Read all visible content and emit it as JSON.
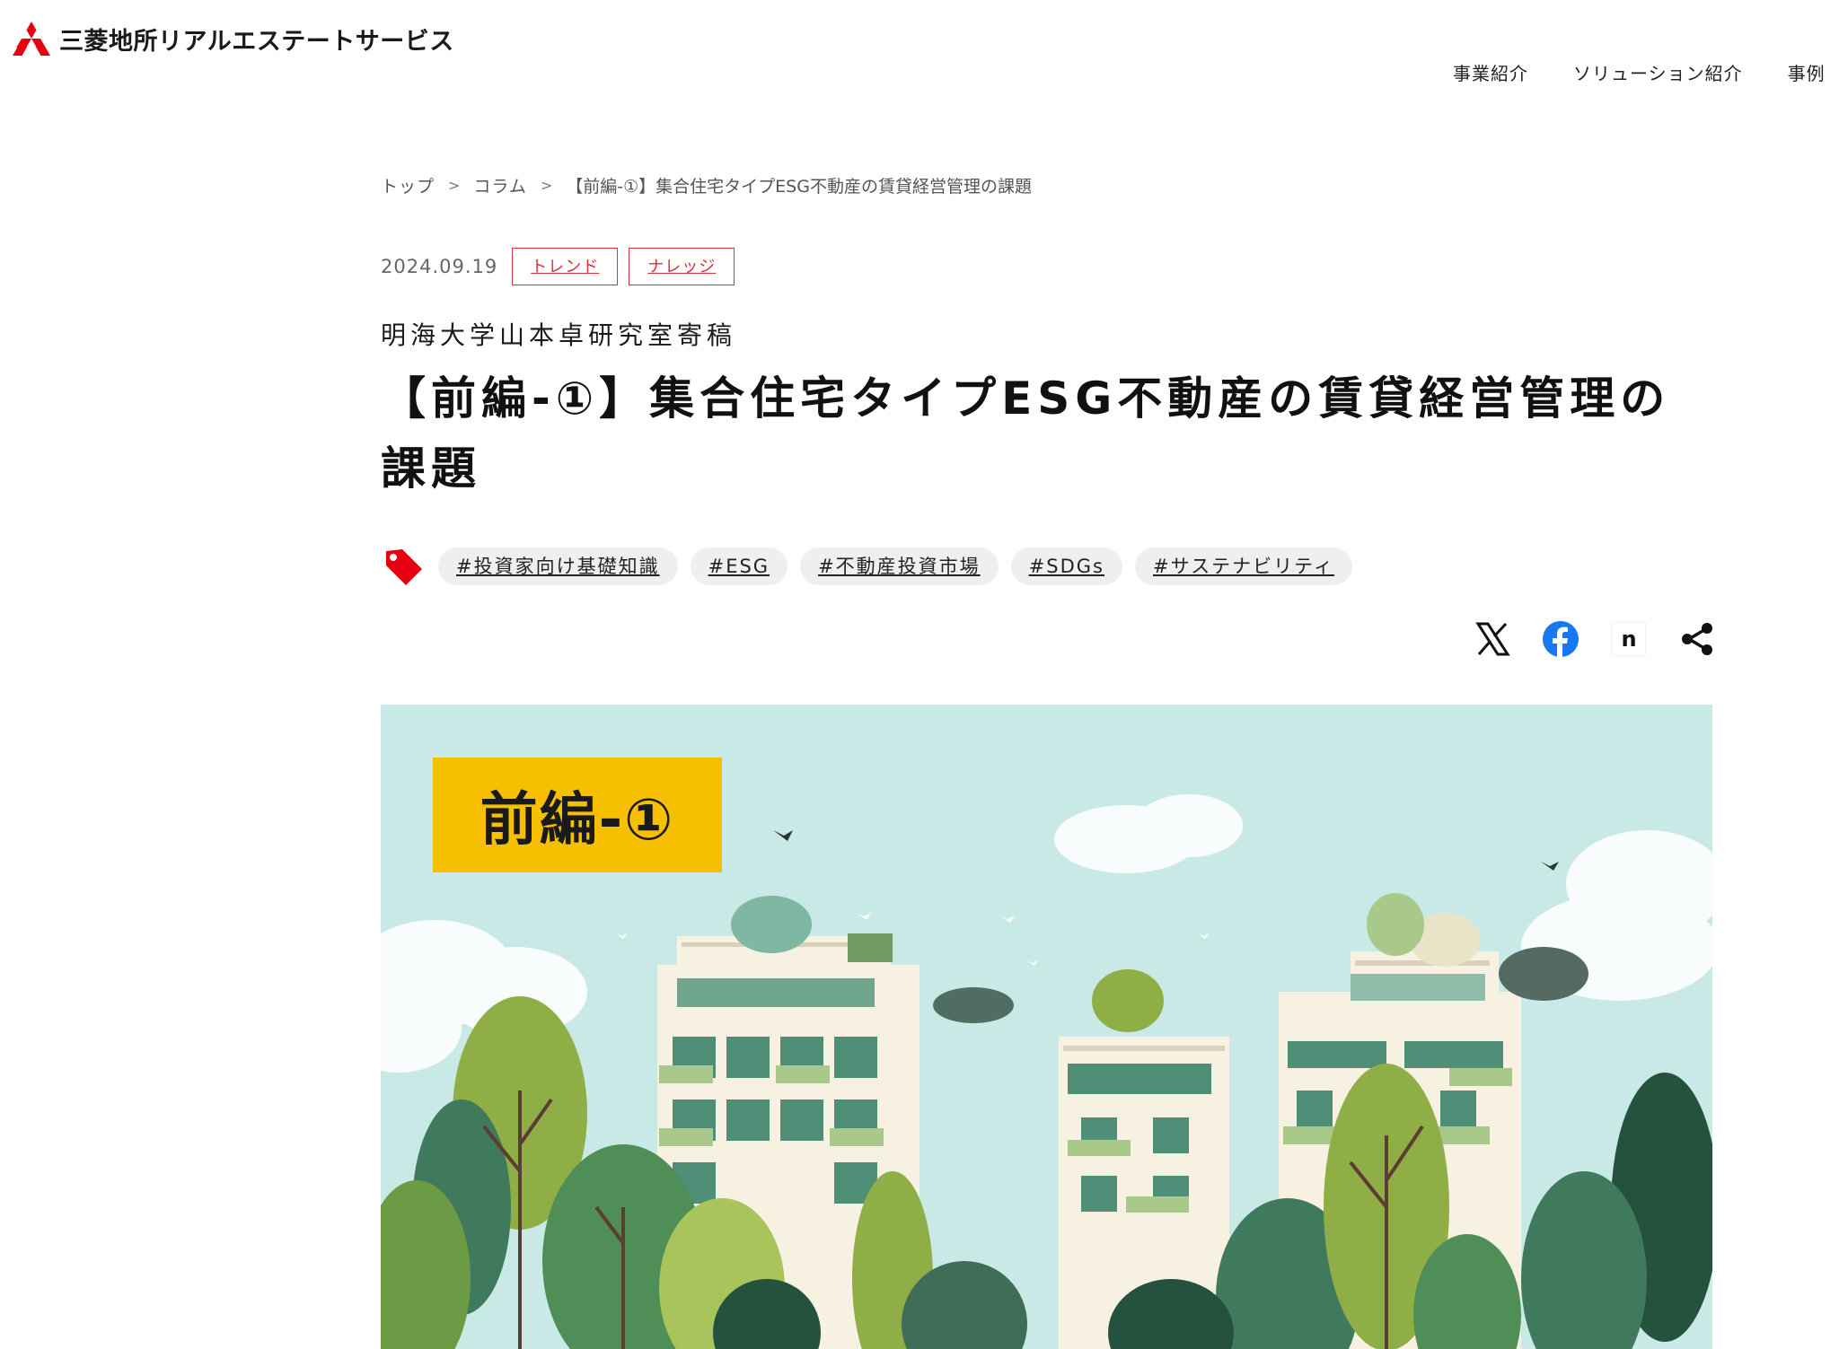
{
  "header": {
    "logo_text": "三菱地所リアルエステートサービス",
    "nav": [
      "事業紹介",
      "ソリューション紹介",
      "事例"
    ]
  },
  "breadcrumb": {
    "items": [
      "トップ",
      "コラム",
      "【前編-①】集合住宅タイプESG不動産の賃貸経営管理の課題"
    ],
    "separator": ">"
  },
  "article": {
    "date": "2024.09.19",
    "categories": [
      "トレンド",
      "ナレッジ"
    ],
    "subtitle": "明海大学山本卓研究室寄稿",
    "title": "【前編-①】集合住宅タイプESG不動産の賃貸経営管理の課題",
    "tags": [
      "#投資家向け基礎知識",
      "#ESG",
      "#不動産投資市場",
      "#SDGs",
      "#サステナビリティ"
    ],
    "share": {
      "icons": [
        "x-icon",
        "facebook-icon",
        "note-icon",
        "share-icon"
      ],
      "note_glyph": "n"
    },
    "hero": {
      "badge_text": "前編-①",
      "badge_color": "#f6c000",
      "sky_color": "#c9e9e6"
    }
  },
  "colors": {
    "accent": "#d7313e",
    "logo_red": "#e60012",
    "facebook": "#1877f2"
  }
}
